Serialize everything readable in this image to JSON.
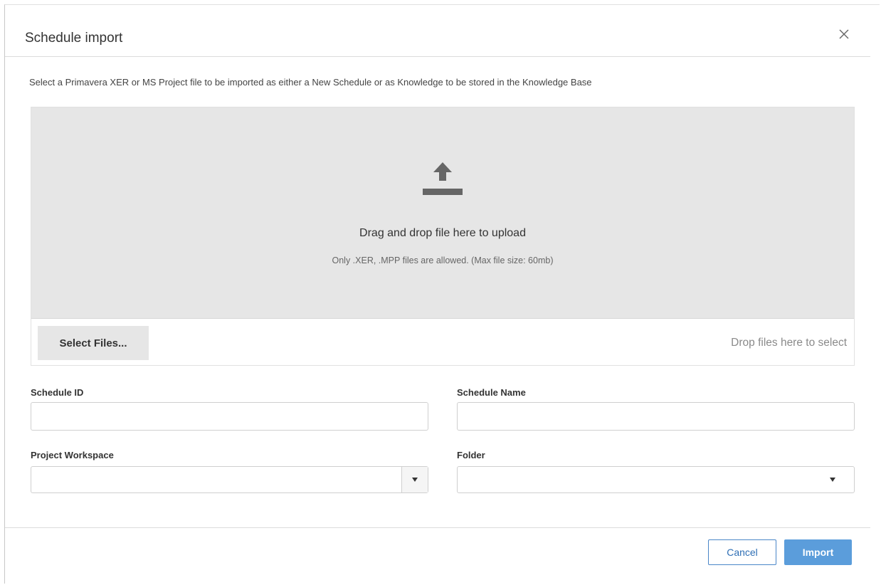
{
  "dialog": {
    "title": "Schedule import",
    "description": "Select a Primavera XER or MS Project file to be imported as either a New Schedule or as Knowledge to be stored in the Knowledge Base",
    "close_icon": "close-icon"
  },
  "upload": {
    "icon": "upload-icon",
    "title": "Drag and drop file here to upload",
    "hint": "Only .XER, .MPP files are allowed. (Max file size: 60mb)",
    "select_button_label": "Select Files...",
    "drop_hint": "Drop files here to select"
  },
  "form": {
    "schedule_id": {
      "label": "Schedule ID",
      "value": ""
    },
    "schedule_name": {
      "label": "Schedule Name",
      "value": ""
    },
    "project_workspace": {
      "label": "Project Workspace",
      "value": ""
    },
    "folder": {
      "label": "Folder",
      "value": ""
    }
  },
  "footer": {
    "cancel_label": "Cancel",
    "import_label": "Import"
  },
  "colors": {
    "primary": "#5b9ddb",
    "link": "#2f6fb5",
    "dropzone_bg": "#e6e6e6"
  }
}
